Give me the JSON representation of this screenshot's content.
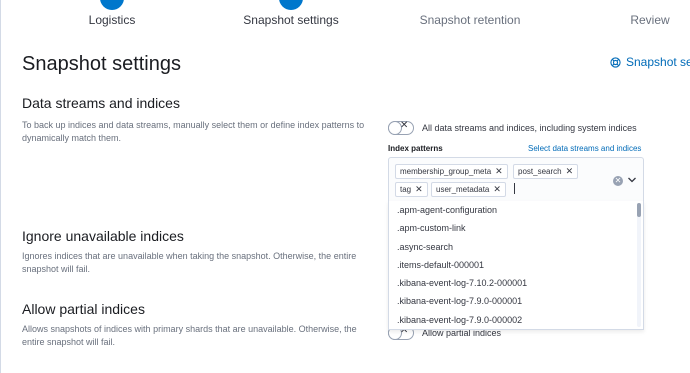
{
  "steps": [
    {
      "label": "Logistics",
      "state": "done"
    },
    {
      "label": "Snapshot settings",
      "state": "current"
    },
    {
      "label": "Snapshot retention",
      "state": "todo"
    },
    {
      "label": "Review",
      "state": "todo"
    }
  ],
  "page": {
    "title": "Snapshot settings",
    "doc_link": "Snapshot settings docs"
  },
  "sections": {
    "indices": {
      "title": "Data streams and indices",
      "description": "To back up indices and data streams, manually select them or define index patterns to dynamically match them.",
      "switch_label": "All data streams and indices, including system indices",
      "field_label": "Index patterns",
      "field_link": "Select data streams and indices",
      "patterns": [
        "membership_group_meta",
        "post_search",
        "tag",
        "user_metadata"
      ],
      "options": [
        ".apm-agent-configuration",
        ".apm-custom-link",
        ".async-search",
        ".items-default-000001",
        ".kibana-event-log-7.10.2-000001",
        ".kibana-event-log-7.9.0-000001",
        ".kibana-event-log-7.9.0-000002"
      ]
    },
    "ignore": {
      "title": "Ignore unavailable indices",
      "description": "Ignores indices that are unavailable when taking the snapshot. Otherwise, the entire snapshot will fail."
    },
    "partial": {
      "title": "Allow partial indices",
      "description": "Allows snapshots of indices with primary shards that are unavailable. Otherwise, the entire snapshot will fail.",
      "switch_label": "Allow partial indices"
    }
  },
  "colors": {
    "accent": "#0077cc",
    "link": "#006bb8"
  }
}
